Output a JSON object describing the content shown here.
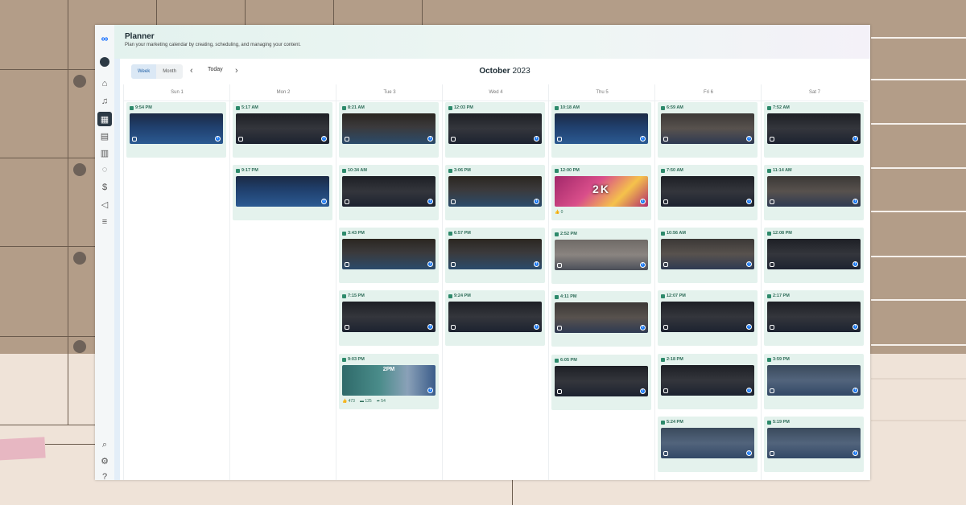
{
  "header": {
    "title": "Planner",
    "subtitle": "Plan your marketing calendar by creating, scheduling, and managing your content."
  },
  "toolbar": {
    "week_label": "Week",
    "month_label": "Month",
    "today_label": "Today",
    "month_name": "October",
    "year": "2023"
  },
  "days": [
    "Sun 1",
    "Mon 2",
    "Tue 3",
    "Wed 4",
    "Thu 5",
    "Fri 6",
    "Sat 7"
  ],
  "posts": {
    "sun": [
      "9:54 PM"
    ],
    "mon": [
      "5:17 AM",
      "9:17 PM"
    ],
    "tue": [
      "8:21 AM",
      "10:34 AM",
      "3:43 PM",
      "7:15 PM",
      "9:03 PM"
    ],
    "wed": [
      "12:03 PM",
      "3:06 PM",
      "6:57 PM",
      "9:24 PM"
    ],
    "thu": [
      "10:18 AM",
      "12:00 PM",
      "2:52 PM",
      "4:11 PM",
      "6:05 PM"
    ],
    "fri": [
      "6:59 AM",
      "7:50 AM",
      "10:56 AM",
      "12:07 PM",
      "2:18 PM",
      "5:24 PM"
    ],
    "sat": [
      "7:52 AM",
      "11:14 AM",
      "12:08 PM",
      "2:17 PM",
      "3:59 PM",
      "5:19 PM"
    ]
  },
  "thumb_text": {
    "thu_1": "2K",
    "tue_4": "2PM"
  },
  "stats": {
    "thu_1_likes": "0",
    "tue_4_likes": "473",
    "tue_4_comments": "125",
    "tue_4_shares": "54"
  },
  "icons": {
    "brand": "meta-logo-icon",
    "nav": [
      "home-icon",
      "notifications-icon",
      "calendar-icon",
      "content-icon",
      "insights-icon",
      "ads-icon",
      "monetization-icon",
      "advertise-icon",
      "menu-icon"
    ],
    "bottom": [
      "search-icon",
      "settings-icon",
      "help-icon"
    ]
  },
  "colors": {
    "card_bg": "#e4f2ed",
    "accent_green": "#2d8a6b",
    "facebook_blue": "#1877f2"
  }
}
